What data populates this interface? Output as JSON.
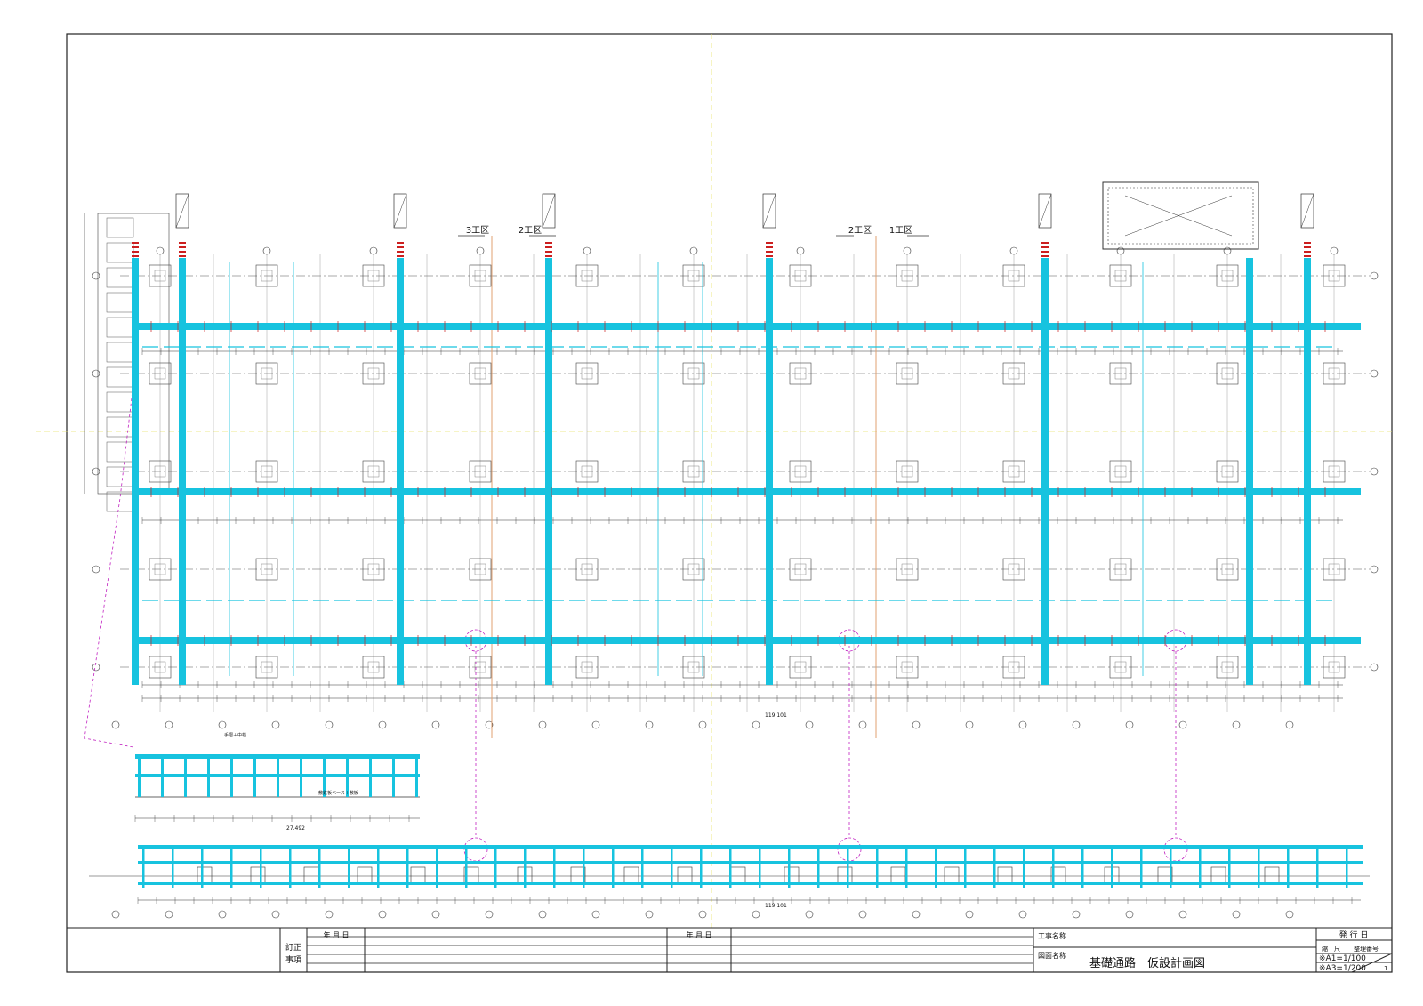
{
  "colors": {
    "background": "#ffffff",
    "linework": "#333333",
    "scaffold": "#17c3df",
    "marker": "#cc1f1f",
    "centerline": "#e0a070",
    "guide": "#e8e36a",
    "callout": "#c020c0"
  },
  "plan": {
    "section_labels": [
      {
        "text": "3工区"
      },
      {
        "text": "2工区"
      },
      {
        "text": "2工区"
      },
      {
        "text": "1工区"
      }
    ],
    "total_length_label": "119.101",
    "elevation_total_label": "27.492",
    "elevation_base_label": "敷鉄板ベース＋敷板",
    "note_tag": "手摺＋中桟"
  },
  "title_block": {
    "date_header_left": "年 月 日",
    "date_header_right": "年 月 日",
    "revision_label_1": "訂正",
    "revision_label_2": "事項",
    "project_name_label": "工事名称",
    "drawing_name_label": "図面名称",
    "drawing_title": "基礎通路　仮設計画図",
    "issue_label": "発 行 日",
    "scale_label_1": "縮",
    "scale_label_2": "尺",
    "management_no_label": "整理番号",
    "scale_a1": "※A1=1/100",
    "scale_a3": "※A3=1/200",
    "sheet_number": "1"
  }
}
